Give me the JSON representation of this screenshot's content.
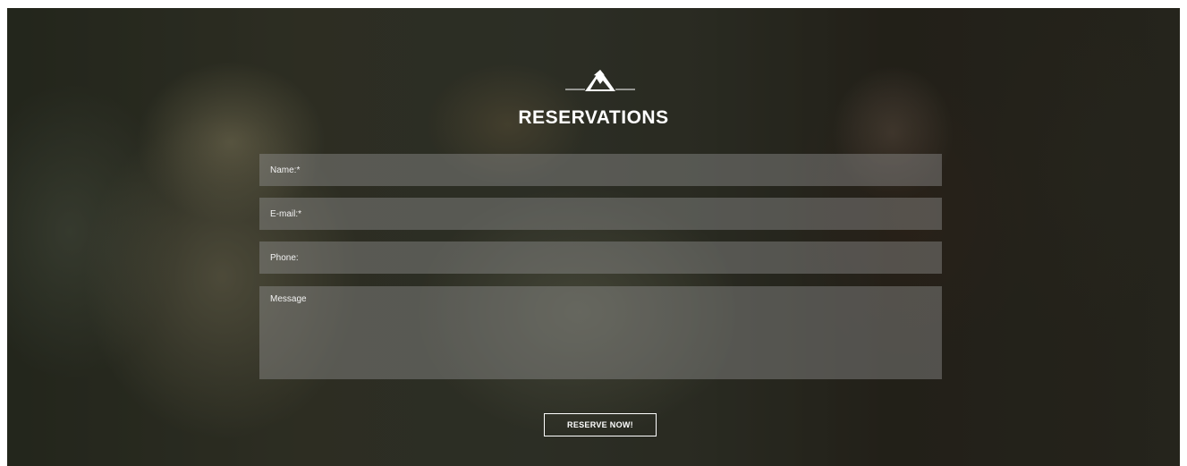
{
  "header": {
    "logo_icon": "mountain-logo-icon",
    "title": "RESERVATIONS"
  },
  "form": {
    "name_placeholder": "Name:*",
    "email_placeholder": "E-mail:*",
    "phone_placeholder": "Phone:",
    "message_placeholder": "Message",
    "submit_label": "RESERVE NOW!"
  },
  "colors": {
    "text": "#ffffff",
    "field_background": "rgba(150,150,150,0.42)"
  }
}
